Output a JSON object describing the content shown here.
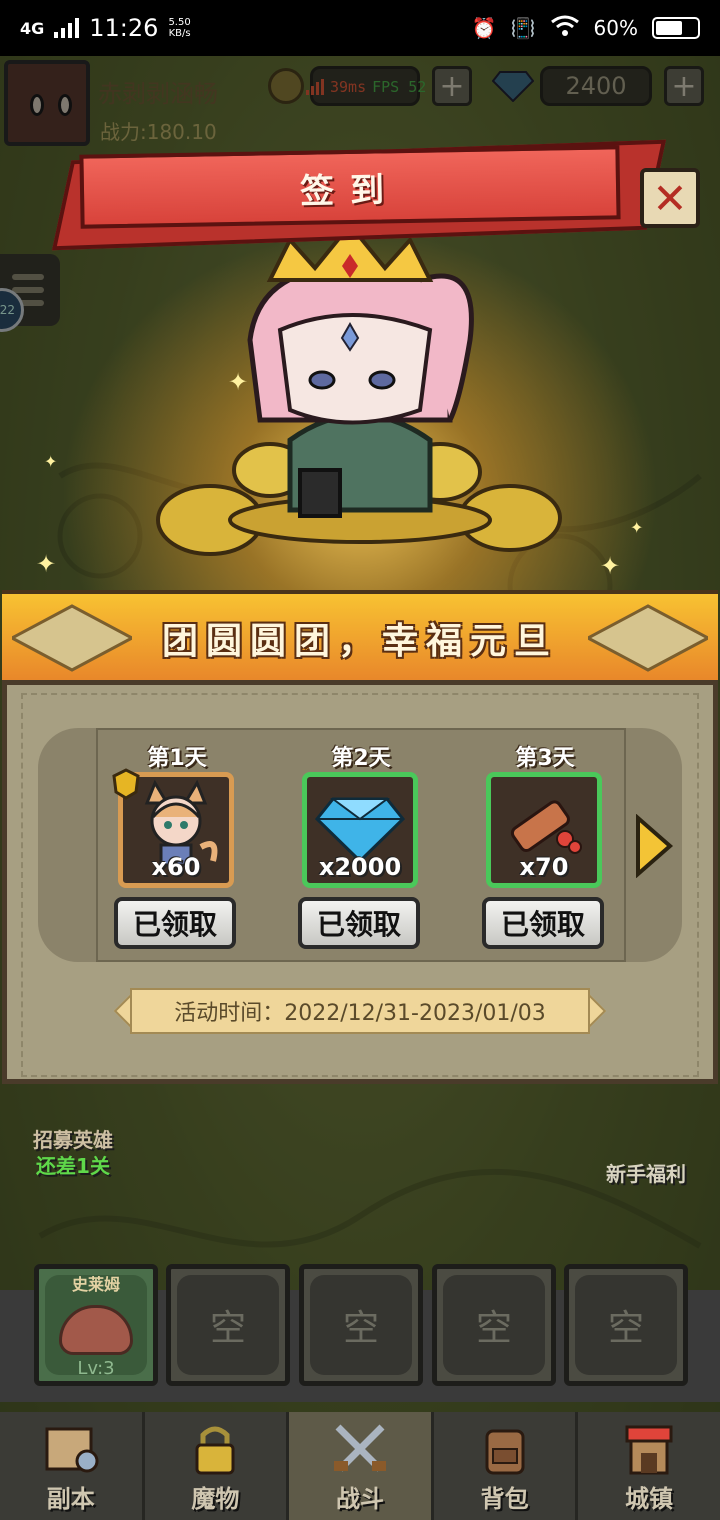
{
  "status_bar": {
    "network": "4G",
    "time": "11:26",
    "net_speed": "5.50",
    "net_speed_unit": "KB/s",
    "battery": "60%"
  },
  "hud": {
    "player_name": "赤剥剥涵畅",
    "power": "战力:180.10",
    "gems": "2400",
    "ping": "39ms",
    "fps": "FPS 52",
    "level_badge": "22"
  },
  "dialog": {
    "title": "签到",
    "event_title": "团圆圆团，幸福元旦",
    "days": [
      {
        "label": "第1天",
        "count": "x60",
        "claim": "已领取",
        "item": "fox-girl-hero-shard"
      },
      {
        "label": "第2天",
        "count": "x2000",
        "claim": "已领取",
        "item": "diamond"
      },
      {
        "label": "第3天",
        "count": "x70",
        "claim": "已领取",
        "item": "scroll"
      }
    ],
    "activity_time": "活动时间：2022/12/31-2023/01/03"
  },
  "side": {
    "recruit": "招募英雄",
    "recruit_sub": "还差1关",
    "newbie": "新手福利"
  },
  "team": {
    "slot1_name": "史莱姆",
    "slot1_level": "Lv:3",
    "empty": "空"
  },
  "nav": [
    {
      "label": "副本",
      "icon": "map-icon"
    },
    {
      "label": "魔物",
      "icon": "lock-icon"
    },
    {
      "label": "战斗",
      "icon": "crossed-swords-icon"
    },
    {
      "label": "背包",
      "icon": "backpack-icon"
    },
    {
      "label": "城镇",
      "icon": "shop-icon"
    }
  ],
  "colors": {
    "banner": "#d8433b",
    "ribbon": "#f0a832",
    "green_border": "#4ac85a",
    "gold_border": "#d89b52"
  }
}
